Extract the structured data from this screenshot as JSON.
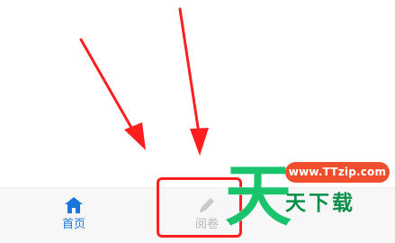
{
  "tabbar": {
    "tabs": [
      {
        "label": "首页",
        "icon": "home-icon",
        "state": "active",
        "color": "#1677d8"
      },
      {
        "label": "阅卷",
        "icon": "pencil-icon",
        "state": "inactive",
        "color": "#b9b9b9"
      }
    ]
  },
  "annotation": {
    "arrow_color": "#ff1f1f",
    "box_color": "#ff1f1f"
  },
  "watermark": {
    "big_char": "天",
    "url": "www.TTzip.com",
    "name": "天下载",
    "primary_color": "#19c46d",
    "badge_color": "#f04e2c"
  }
}
